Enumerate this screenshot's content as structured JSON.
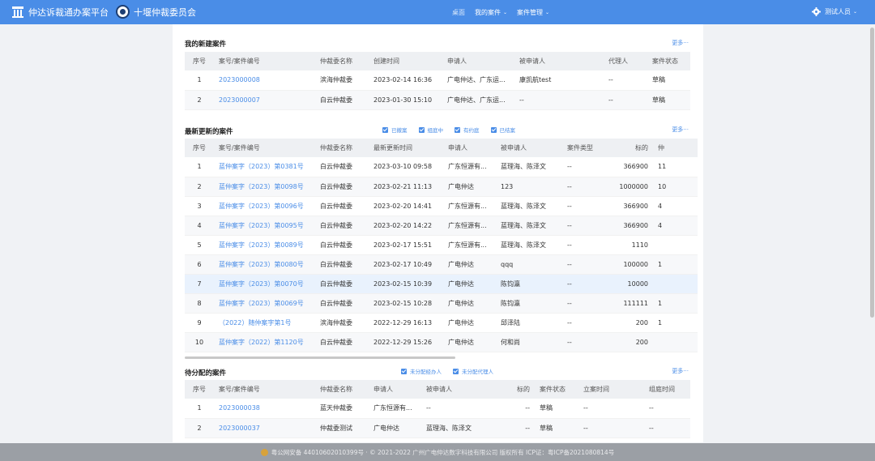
{
  "header": {
    "app_name": "仲达诉裁通办案平台",
    "org_name": "十堰仲裁委员会",
    "nav": [
      {
        "label": "桌面",
        "has_caret": false
      },
      {
        "label": "我的案件",
        "has_caret": true
      },
      {
        "label": "案件管理",
        "has_caret": true
      }
    ],
    "user": "测试人员"
  },
  "new_cases": {
    "title": "我的新建案件",
    "more": "更多···",
    "columns": [
      "序号",
      "案号/案件编号",
      "仲裁委名称",
      "创建时间",
      "申请人",
      "被申请人",
      "代理人",
      "案件状态"
    ],
    "rows": [
      [
        "1",
        "2023000008",
        "滨海仲裁委",
        "2023-02-14 16:36",
        "广电仲达、广东运...",
        "康凯航test",
        "--",
        "草稿"
      ],
      [
        "2",
        "2023000007",
        "白云仲裁委",
        "2023-01-30 15:10",
        "广电仲达、广东运...",
        "--",
        "--",
        "草稿"
      ]
    ]
  },
  "updated_cases": {
    "title": "最新更新的案件",
    "more": "更多···",
    "filters": [
      "已撤案",
      "组庭中",
      "有约庭",
      "已结案"
    ],
    "columns": [
      "序号",
      "案号/案件编号",
      "仲裁委名称",
      "最新更新时间",
      "申请人",
      "被申请人",
      "案件类型",
      "标的",
      "仲"
    ],
    "rows": [
      [
        "1",
        "蓝仲案字（2023）第0381号",
        "白云仲裁委",
        "2023-03-10 09:58",
        "广东恒源有...",
        "蓝理海、陈泽文",
        "--",
        "366900",
        "11"
      ],
      [
        "2",
        "蓝仲案字（2023）第0098号",
        "白云仲裁委",
        "2023-02-21 11:13",
        "广电仲达",
        "123",
        "--",
        "1000000",
        "10"
      ],
      [
        "3",
        "蓝仲案字（2023）第0096号",
        "白云仲裁委",
        "2023-02-20 14:41",
        "广东恒源有...",
        "蓝理海、陈泽文",
        "--",
        "366900",
        "4"
      ],
      [
        "4",
        "蓝仲案字（2023）第0095号",
        "白云仲裁委",
        "2023-02-20 14:22",
        "广东恒源有...",
        "蓝理海、陈泽文",
        "--",
        "366900",
        "4"
      ],
      [
        "5",
        "蓝仲案字（2023）第0089号",
        "白云仲裁委",
        "2023-02-17 15:51",
        "广东恒源有...",
        "蓝理海、陈泽文",
        "--",
        "1110",
        ""
      ],
      [
        "6",
        "蓝仲案字（2023）第0080号",
        "白云仲裁委",
        "2023-02-17 10:49",
        "广电仲达",
        "qqq",
        "--",
        "100000",
        "1"
      ],
      [
        "7",
        "蓝仲案字（2023）第0070号",
        "白云仲裁委",
        "2023-02-15 10:39",
        "广电仲达",
        "陈钧瀛",
        "--",
        "10000",
        ""
      ],
      [
        "8",
        "蓝仲案字（2023）第0069号",
        "白云仲裁委",
        "2023-02-15 10:28",
        "广电仲达",
        "陈钧瀛",
        "--",
        "111111",
        "1"
      ],
      [
        "9",
        "（2022）随仲案字第1号",
        "滨海仲裁委",
        "2022-12-29 16:13",
        "广电仲达",
        "邱泽陆",
        "--",
        "200",
        "1"
      ],
      [
        "10",
        "蓝仲案字（2022）第1120号",
        "白云仲裁委",
        "2022-12-29 15:26",
        "广电仲达",
        "何和尚",
        "--",
        "200",
        ""
      ]
    ]
  },
  "pending_cases": {
    "title": "待分配的案件",
    "more": "更多···",
    "filters": [
      "未分配经办人",
      "未分配代理人"
    ],
    "columns": [
      "序号",
      "案号/案件编号",
      "仲裁委名称",
      "申请人",
      "被申请人",
      "标的",
      "案件状态",
      "立案时间",
      "组庭时间"
    ],
    "rows": [
      [
        "1",
        "2023000038",
        "蓝天仲裁委",
        "广东恒源有...",
        "--",
        "--",
        "草稿",
        "--",
        "--"
      ],
      [
        "2",
        "2023000037",
        "仲裁委测试",
        "广电仲达",
        "蓝理海、陈泽文",
        "--",
        "草稿",
        "--",
        "--"
      ]
    ]
  },
  "footer": {
    "text": "粤公网安备 44010602010399号 · © 2021-2022 广州广电仲达数字科技有限公司 版权所有 ICP证：粤ICP备2021080814号"
  },
  "colors": {
    "primary": "#4a8de7",
    "header_bg": "#4a8de7",
    "footer_bg": "#9b9fa5",
    "highlight_row": "#e9f2fd"
  }
}
